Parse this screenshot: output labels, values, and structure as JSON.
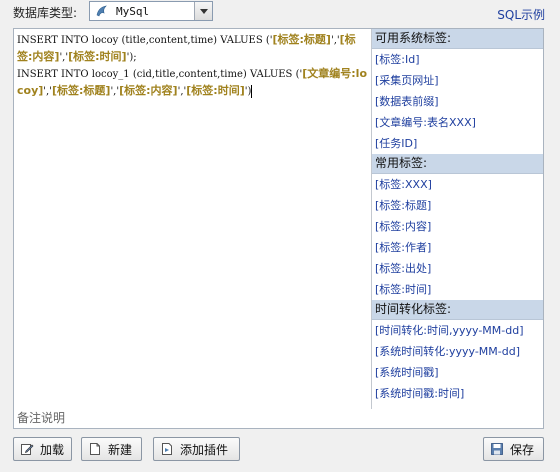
{
  "toolbar": {
    "db_label": "数据库类型:",
    "db_value": "MySql",
    "sql_example": "SQL示例"
  },
  "editor": {
    "line1_a": "INSERT INTO locoy (title,content,time) VALUES ('",
    "line1_t1": "[标签:标题]",
    "line1_b": "','",
    "line1_t2": "[标签:内容]",
    "line1_c": "','",
    "line1_t3": "[标签:时间]",
    "line1_d": "');",
    "line2_a": "INSERT INTO locoy_1 (cid,title,content,time) VALUES ('",
    "line2_t1": "[文章编号:locoy]",
    "line2_b": "','",
    "line2_t2": "[标签:标题]",
    "line2_c": "','",
    "line2_t3": "[标签:内容]",
    "line2_d": "','",
    "line2_t4": "[标签:时间]",
    "line2_e": "')"
  },
  "tag_panel": {
    "groups": [
      {
        "header": "可用系统标签:",
        "items": [
          "[标签:Id]",
          "[采集页网址]",
          "[数据表前缀]",
          "[文章编号:表名XXX]",
          "[任务ID]"
        ]
      },
      {
        "header": "常用标签:",
        "items": [
          "[标签:XXX]",
          "[标签:标题]",
          "[标签:内容]",
          "[标签:作者]",
          "[标签:出处]",
          "[标签:时间]"
        ]
      },
      {
        "header": "时间转化标签:",
        "items": [
          "[时间转化:时间,yyyy-MM-dd]",
          "[系统时间转化:yyyy-MM-dd]",
          "[系统时间戳]",
          "[系统时间戳:时间]"
        ]
      }
    ]
  },
  "remark": "备注说明",
  "buttons": {
    "load": "加载",
    "new": "新建",
    "add_plugin": "添加插件",
    "save": "保存"
  }
}
